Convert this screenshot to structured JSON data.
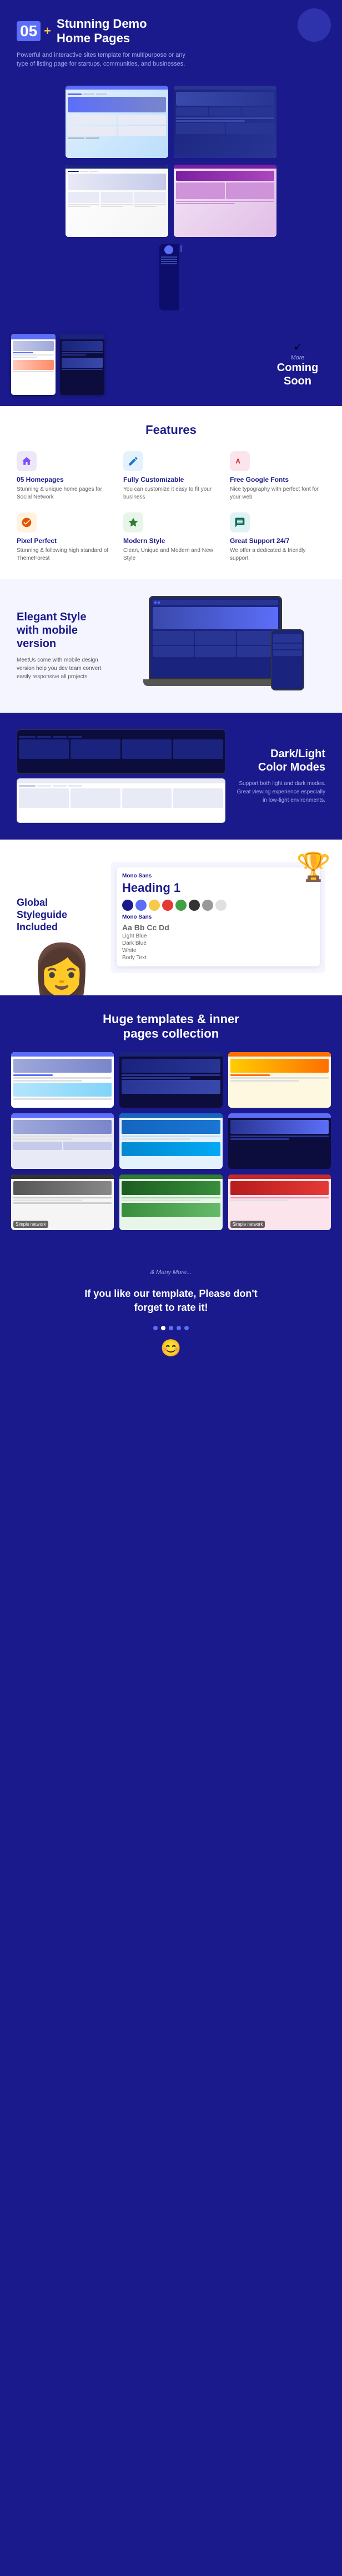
{
  "hero": {
    "badge_num": "05",
    "badge_plus": "+",
    "title_line1": "Stunning Demo",
    "title_line2": "Home Pages",
    "subtitle": "Powerful and interactive sites template for multipurpose or any type of listing page for startups, communities, and businesses."
  },
  "coming_soon": {
    "label": "More",
    "title": "Coming Soon"
  },
  "features": {
    "section_title": "Features",
    "items": [
      {
        "id": "homepages",
        "icon": "🏠",
        "icon_color": "purple",
        "name": "05 Homepages",
        "desc": "Stunning & unique home pages for Social Network"
      },
      {
        "id": "customizable",
        "icon": "✏️",
        "icon_color": "blue",
        "name": "Fully Customizable",
        "desc": "You can customize it easy to fit your business"
      },
      {
        "id": "google-fonts",
        "icon": "A",
        "icon_color": "pink",
        "name": "Free Google Fonts",
        "desc": "Nice typography with perfect font for your web"
      },
      {
        "id": "pixel-perfect",
        "icon": "⬛",
        "icon_color": "orange",
        "name": "Pixel Perfect",
        "desc": "Stunning & following high standard of ThemeForest"
      },
      {
        "id": "modern-style",
        "icon": "✨",
        "icon_color": "green",
        "name": "Modern Style",
        "desc": "Clean, Unique and Modern and New Style"
      },
      {
        "id": "support",
        "icon": "💬",
        "icon_color": "teal",
        "name": "Great Support 24/7",
        "desc": "We offer a dedicated & friendly support"
      }
    ]
  },
  "elegant": {
    "title": "Elegant Style\nwith mobile version",
    "desc": "MeetUs come with mobile design version help you dev team convert easily responsive all projects"
  },
  "darklight": {
    "title": "Dark/Light\nColor Modes",
    "desc": "Support both light and dark modes. Great viewing experience especially in low-light environments."
  },
  "styleguide": {
    "title": "Global\nStyleguide\nIncluded",
    "mono_sans_label": "Mono Sans",
    "heading_sample": "Heading 1",
    "mono_sans_label2": "Mono Sans"
  },
  "inner_pages": {
    "title": "Huge templates & inner\npages collection",
    "cards": [
      {
        "label": ""
      },
      {
        "label": ""
      },
      {
        "label": ""
      },
      {
        "label": ""
      },
      {
        "label": ""
      },
      {
        "label": ""
      },
      {
        "label": "Simple network"
      },
      {
        "label": ""
      },
      {
        "label": "Simple network"
      }
    ]
  },
  "footer": {
    "many_more": "& Many More...",
    "cta": "If you like our template, Please don't\nforget to rate it!",
    "emoji": "😊"
  }
}
